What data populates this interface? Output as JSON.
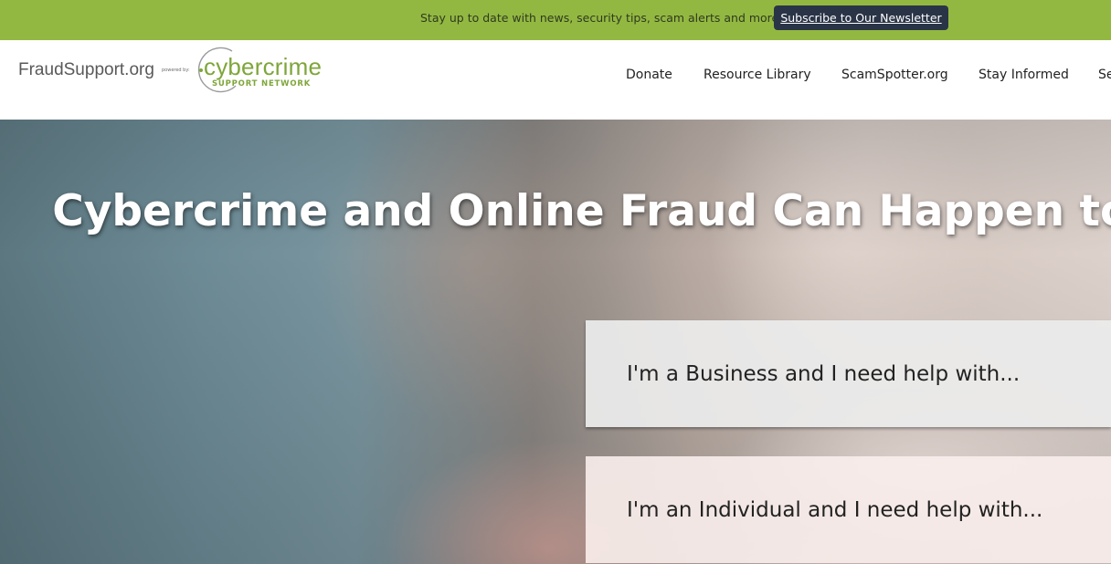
{
  "promo": {
    "text": "Stay up to date with news, security tips, scam alerts and more.",
    "button_label": "Subscribe to Our Newsletter"
  },
  "logo": {
    "site_name": "FraudSupport.org",
    "powered_by": "powered by:",
    "brand": "cybercrime",
    "brand_sub": "SUPPORT NETWORK"
  },
  "nav": {
    "items": [
      {
        "label": "Donate"
      },
      {
        "label": "Resource Library"
      },
      {
        "label": "ScamSpotter.org"
      },
      {
        "label": "Stay Informed"
      },
      {
        "label": "Se"
      }
    ]
  },
  "hero": {
    "title": "Cybercrime and Online Fraud Can Happen to Anyone",
    "business_card": "I'm a Business and I need help with...",
    "individual_card": "I'm an Individual and I need help with..."
  },
  "colors": {
    "promo_bar": "#93b842",
    "promo_button": "#2a3447",
    "brand_green": "#7ea63a"
  }
}
